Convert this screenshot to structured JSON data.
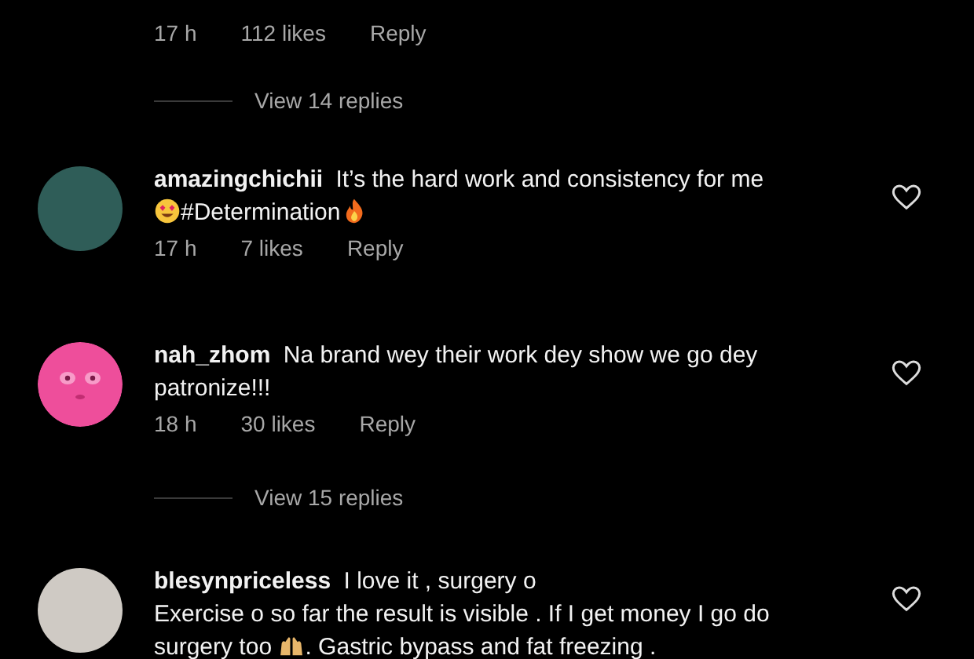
{
  "top_thread": {
    "meta": {
      "time": "17 h",
      "likes": "112 likes",
      "reply": "Reply"
    },
    "view_replies": "View 14 replies"
  },
  "comments": [
    {
      "username": "amazingchichii",
      "avatar": {
        "kind": "photo"
      },
      "liked": false,
      "lines": [
        [
          {
            "kind": "text",
            "text": "It’s the hard work and consistency for me"
          }
        ],
        [
          {
            "kind": "smile"
          },
          {
            "kind": "text",
            "text": "#Determination"
          },
          {
            "kind": "fire"
          }
        ]
      ],
      "meta": {
        "time": "17 h",
        "likes": "7 likes",
        "reply": "Reply"
      }
    },
    {
      "username": "nah_zhom",
      "avatar": {
        "kind": "cartoon"
      },
      "liked": false,
      "lines": [
        [
          {
            "kind": "text",
            "text": "Na brand wey their work dey show we go dey"
          }
        ],
        [
          {
            "kind": "text",
            "text": "patronize!!!"
          }
        ]
      ],
      "meta": {
        "time": "18 h",
        "likes": "30 likes",
        "reply": "Reply"
      },
      "view_replies": "View 15 replies"
    },
    {
      "username": "blesynpriceless",
      "avatar": {
        "kind": "photo-light"
      },
      "liked": false,
      "lines": [
        [
          {
            "kind": "text",
            "text": "I love it , surgery o"
          }
        ],
        [
          {
            "kind": "text",
            "text": "Exercise o so far the result is visible . If I get money I go do"
          }
        ],
        [
          {
            "kind": "text",
            "text": "surgery too "
          },
          {
            "kind": "hands"
          },
          {
            "kind": "text",
            "text": ". Gastric bypass and fat freezing ."
          }
        ]
      ]
    }
  ]
}
